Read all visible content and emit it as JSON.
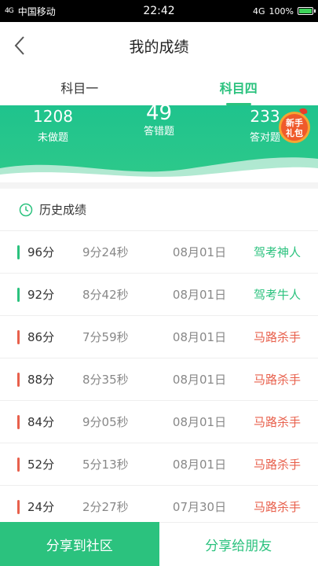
{
  "status_bar": {
    "signal": "4G",
    "carrier": "中国移动",
    "time": "22:42",
    "network": "4G",
    "battery": "100%"
  },
  "header": {
    "title": "我的成绩"
  },
  "tabs": [
    {
      "label": "科目一",
      "active": false
    },
    {
      "label": "科目四",
      "active": true
    }
  ],
  "stats": [
    {
      "value": "1208",
      "label": "未做题"
    },
    {
      "value": "49",
      "label": "答错题"
    },
    {
      "value": "233",
      "label": "答对题"
    }
  ],
  "gift_badge": {
    "line1": "新手",
    "line2": "礼包"
  },
  "history": {
    "title": "历史成绩",
    "rows": [
      {
        "score": "96分",
        "duration": "9分24秒",
        "date": "08月01日",
        "tag": "驾考神人",
        "pass": true
      },
      {
        "score": "92分",
        "duration": "8分42秒",
        "date": "08月01日",
        "tag": "驾考牛人",
        "pass": true
      },
      {
        "score": "86分",
        "duration": "7分59秒",
        "date": "08月01日",
        "tag": "马路杀手",
        "pass": false
      },
      {
        "score": "88分",
        "duration": "8分35秒",
        "date": "08月01日",
        "tag": "马路杀手",
        "pass": false
      },
      {
        "score": "84分",
        "duration": "9分05秒",
        "date": "08月01日",
        "tag": "马路杀手",
        "pass": false
      },
      {
        "score": "52分",
        "duration": "5分13秒",
        "date": "08月01日",
        "tag": "马路杀手",
        "pass": false
      },
      {
        "score": "24分",
        "duration": "2分27秒",
        "date": "07月30日",
        "tag": "马路杀手",
        "pass": false
      }
    ]
  },
  "footer": {
    "share_community": "分享到社区",
    "share_friends": "分享给朋友"
  },
  "colors": {
    "accent": "#2bc27e",
    "pass": "#2bc27e",
    "fail": "#e8604c"
  }
}
